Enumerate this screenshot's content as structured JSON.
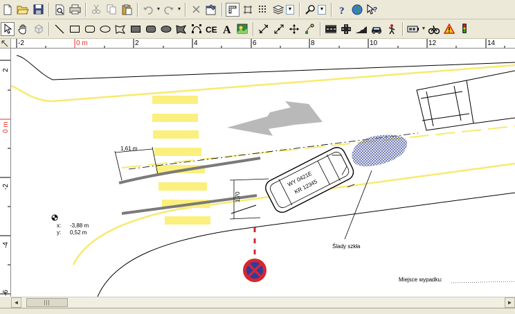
{
  "toolbar_top": {
    "buttons": [
      {
        "name": "new-file-icon"
      },
      {
        "name": "open-folder-icon"
      },
      {
        "name": "save-icon"
      },
      {
        "name": "print-preview-icon"
      },
      {
        "name": "print-icon"
      },
      {
        "name": "cut-icon"
      },
      {
        "name": "copy-icon"
      },
      {
        "name": "paste-icon"
      },
      {
        "name": "undo-icon"
      },
      {
        "name": "redo-icon"
      },
      {
        "name": "delete-icon"
      },
      {
        "name": "properties-icon"
      },
      {
        "name": "ruler-toggle-icon"
      },
      {
        "name": "page-frame-icon"
      },
      {
        "name": "grid-icon"
      },
      {
        "name": "layers-icon"
      },
      {
        "name": "zoom-icon"
      },
      {
        "name": "help-icon"
      },
      {
        "name": "web-help-icon"
      },
      {
        "name": "context-help-icon"
      }
    ]
  },
  "toolbar_draw": {
    "buttons": [
      {
        "name": "select-arrow-icon"
      },
      {
        "name": "pan-hand-icon"
      },
      {
        "name": "cube-icon"
      },
      {
        "name": "line-icon"
      },
      {
        "name": "rectangle-icon"
      },
      {
        "name": "rounded-rectangle-icon"
      },
      {
        "name": "ellipse-icon"
      },
      {
        "name": "polygon-icon"
      },
      {
        "name": "filled-rectangle-icon"
      },
      {
        "name": "filled-rounded-rectangle-icon"
      },
      {
        "name": "filled-ellipse-icon"
      },
      {
        "name": "filled-polygon-icon"
      },
      {
        "name": "bezier-icon"
      },
      {
        "name": "ce-mark-icon"
      },
      {
        "name": "text-icon"
      },
      {
        "name": "image-icon"
      },
      {
        "name": "dimension-icon"
      },
      {
        "name": "measure-angle-icon"
      },
      {
        "name": "move-icon"
      },
      {
        "name": "transform-icon"
      },
      {
        "name": "road-element-icon"
      },
      {
        "name": "junction-icon"
      },
      {
        "name": "slope-icon"
      },
      {
        "name": "car-icon"
      },
      {
        "name": "figure-icon"
      },
      {
        "name": "battery-icon"
      },
      {
        "name": "bicycle-icon"
      },
      {
        "name": "warning-sign-icon"
      },
      {
        "name": "traffic-light-icon"
      }
    ],
    "labels": {
      "ce": "CE",
      "text": "A"
    }
  },
  "ruler": {
    "unit_label": "0 m",
    "h_ticks": [
      "-2",
      "0 m",
      "2",
      "4",
      "6",
      "8",
      "10",
      "12",
      "14"
    ],
    "v_ticks": [
      "2",
      "0 m",
      "-2",
      "-4",
      "-6"
    ]
  },
  "canvas": {
    "vehicle_plate_line1": "WY 0421E",
    "vehicle_plate_line2": "KR 12345",
    "dim_width": "1,61 m",
    "dim_offset": "1,70",
    "glass_label": "Ślady szkła",
    "coord_x_label": "x:",
    "coord_x_value": "-3,88 m",
    "coord_y_label": "y:",
    "coord_y_value": "0,52 m",
    "place_label": "Miejsce wypadku:"
  },
  "colors": {
    "road_line": "#f7ea6e",
    "crosswalk": "#fbf07e",
    "skid": "#7a7a7a",
    "arrow": "#b9b9b9",
    "glass_hatch": "#5b66a8",
    "sign_red": "#d8262e",
    "sign_blue": "#2b3ea0",
    "ruler_red": "#e0302a"
  }
}
